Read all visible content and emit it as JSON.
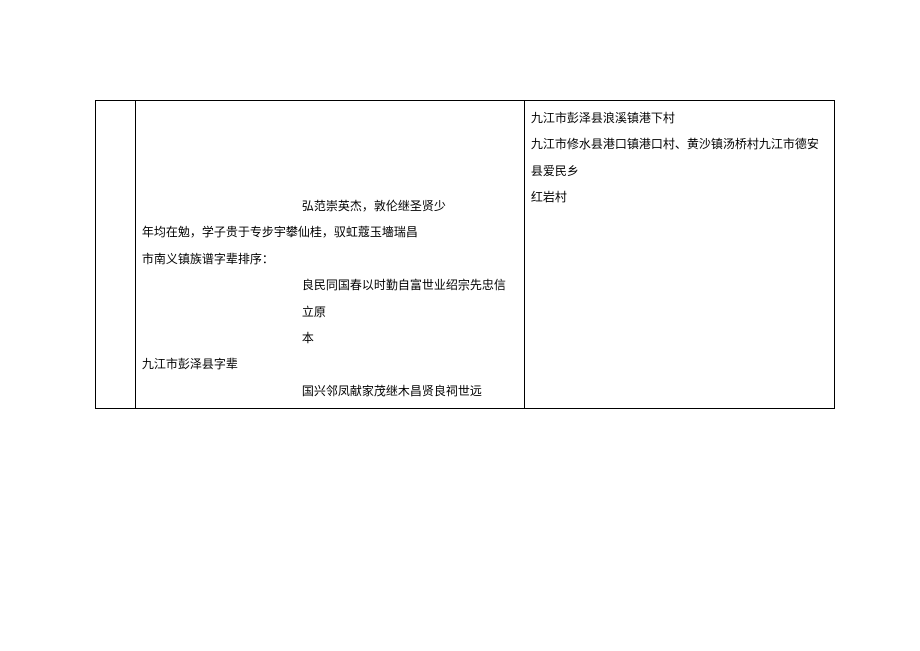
{
  "table": {
    "col2": {
      "line1_indent": "弘范崇英杰，敦伦继圣贤少",
      "line2": "年均在勉，学子贵于专步宇攀仙桂，驭虹蔻玉墻瑞昌",
      "line3": "市南义镇族谱字辈排序：",
      "line4_indent": "良民同国春以时勤自富世业绍宗先忠信立原",
      "line5_indent": "本",
      "line6": "九江市彭泽县字辈",
      "line7_indent": "国兴邻凤献家茂继木昌贤良祠世远"
    },
    "col3": {
      "line1": "九江市彭泽县浪溪镇港下村",
      "line2": "九江市修水县港口镇港口村、黄沙镇汤桥村九江市德安县爱民乡",
      "line3": "红岩村"
    }
  }
}
